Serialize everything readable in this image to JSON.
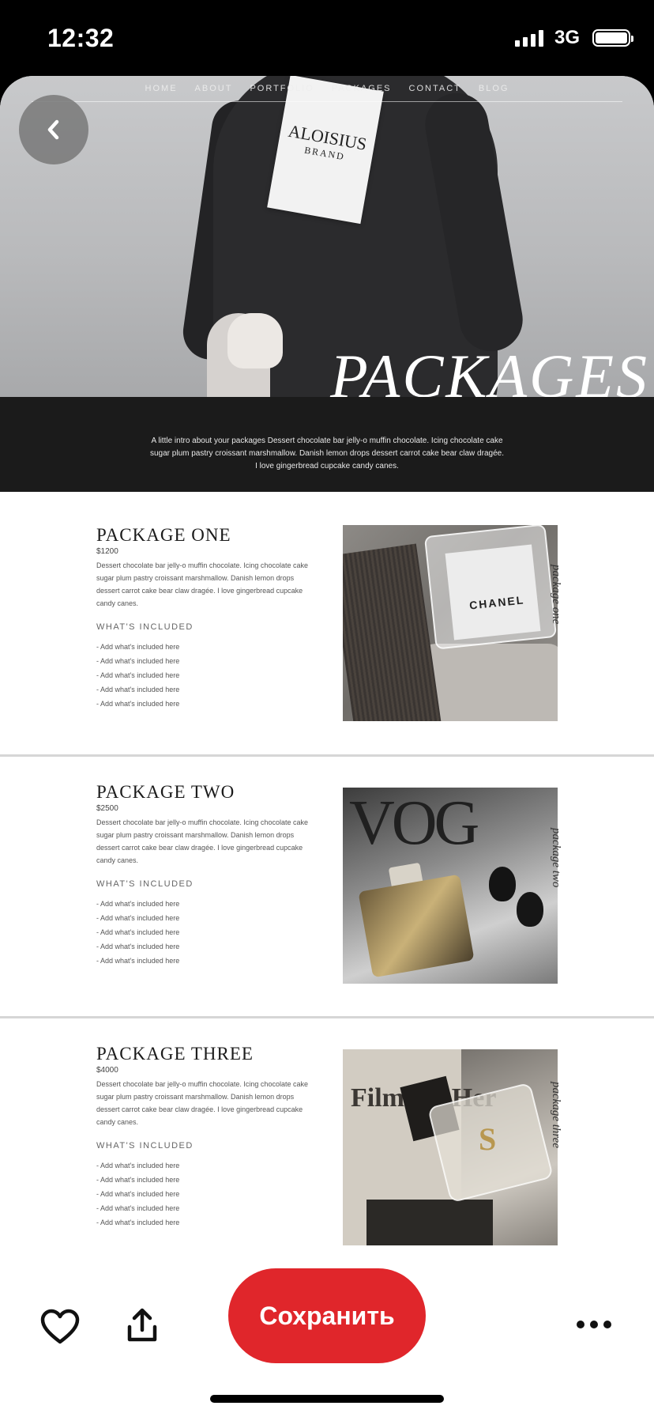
{
  "status": {
    "time": "12:32",
    "network": "3G",
    "icons": [
      "signal-icon",
      "battery-icon"
    ]
  },
  "hero": {
    "nav": [
      "HOME",
      "ABOUT",
      "PORTFOLIO",
      "PACKAGES",
      "CONTACT",
      "BLOG"
    ],
    "tag_brand": "ALOISIUS",
    "tag_sub": "BRAND",
    "title": "PACKAGES"
  },
  "intro": "A little intro about your packages Dessert chocolate bar jelly-o muffin chocolate. Icing chocolate cake sugar plum pastry croissant marshmallow. Danish lemon drops dessert carrot cake bear claw dragée. I love gingerbread cupcake candy canes.",
  "packages": [
    {
      "title": "PACKAGE ONE",
      "price": "$1200",
      "desc": "Dessert chocolate bar jelly-o muffin chocolate. Icing chocolate cake sugar plum pastry croissant marshmallow. Danish lemon drops dessert carrot cake bear claw dragée. I love gingerbread cupcake candy canes.",
      "included_label": "WHAT'S INCLUDED",
      "items": [
        "- Add what's included here",
        "- Add what's included here",
        "- Add what's included here",
        "- Add what's included here",
        "- Add what's included here"
      ],
      "script": "package one",
      "photo_text": "CHANEL"
    },
    {
      "title": "PACKAGE TWO",
      "price": "$2500",
      "desc": "Dessert chocolate bar jelly-o muffin chocolate. Icing chocolate cake sugar plum pastry croissant marshmallow. Danish lemon drops dessert carrot cake bear claw dragée. I love gingerbread cupcake candy canes.",
      "included_label": "WHAT'S INCLUDED",
      "items": [
        "- Add what's included here",
        "- Add what's included here",
        "- Add what's included here",
        "- Add what's included here",
        "- Add what's included here"
      ],
      "script": "package two",
      "photo_text": "VOG"
    },
    {
      "title": "PACKAGE THREE",
      "price": "$4000",
      "desc": "Dessert chocolate bar jelly-o muffin chocolate. Icing chocolate cake sugar plum pastry croissant marshmallow. Danish lemon drops dessert carrot cake bear claw dragée. I love gingerbread cupcake candy canes.",
      "included_label": "WHAT'S INCLUDED",
      "items": [
        "- Add what's included here",
        "- Add what's included here",
        "- Add what's included here",
        "- Add what's included here",
        "- Add what's included here"
      ],
      "script": "package three",
      "photo_text": "Film for Her"
    }
  ],
  "actions": {
    "save_label": "Сохранить",
    "icons": [
      "heart-icon",
      "share-icon",
      "more-icon"
    ]
  },
  "colors": {
    "save": "#e0262b",
    "dark_band": "#1b1b1b"
  }
}
